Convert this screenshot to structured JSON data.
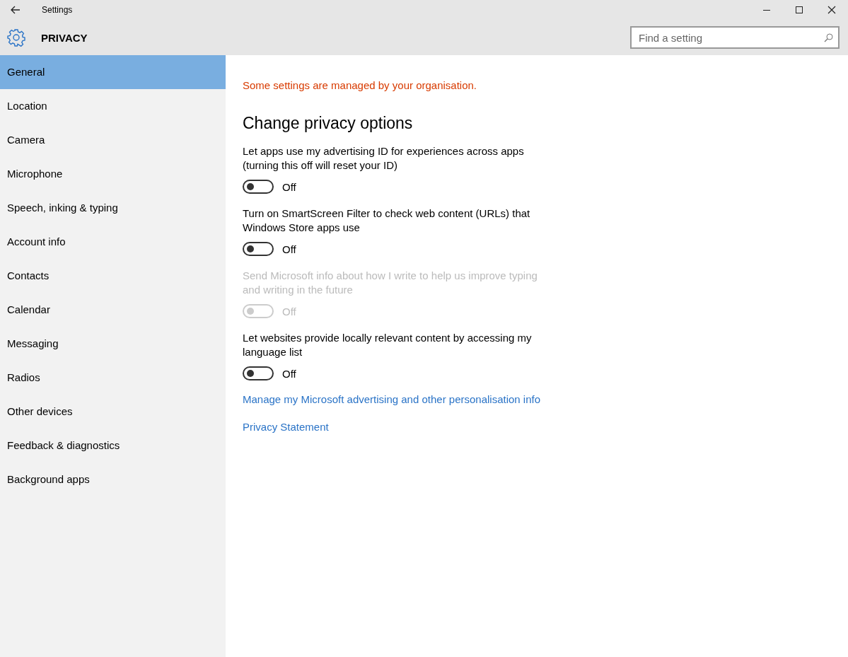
{
  "window": {
    "title": "Settings"
  },
  "header": {
    "title": "PRIVACY",
    "search": {
      "placeholder": "Find a setting"
    }
  },
  "sidebar": {
    "items": [
      {
        "label": "General",
        "selected": true
      },
      {
        "label": "Location",
        "selected": false
      },
      {
        "label": "Camera",
        "selected": false
      },
      {
        "label": "Microphone",
        "selected": false
      },
      {
        "label": "Speech, inking & typing",
        "selected": false
      },
      {
        "label": "Account info",
        "selected": false
      },
      {
        "label": "Contacts",
        "selected": false
      },
      {
        "label": "Calendar",
        "selected": false
      },
      {
        "label": "Messaging",
        "selected": false
      },
      {
        "label": "Radios",
        "selected": false
      },
      {
        "label": "Other devices",
        "selected": false
      },
      {
        "label": "Feedback & diagnostics",
        "selected": false
      },
      {
        "label": "Background apps",
        "selected": false
      }
    ]
  },
  "content": {
    "notice": "Some settings are managed by your organisation.",
    "heading": "Change privacy options",
    "settings": [
      {
        "label": "Let apps use my advertising ID for experiences across apps (turning this off will reset your ID)",
        "on": false,
        "disabled": false,
        "state_label": "Off"
      },
      {
        "label": "Turn on SmartScreen Filter to check web content (URLs) that Windows Store apps use",
        "on": false,
        "disabled": false,
        "state_label": "Off"
      },
      {
        "label": "Send Microsoft info about how I write to help us improve typing and writing in the future",
        "on": false,
        "disabled": true,
        "state_label": "Off"
      },
      {
        "label": "Let websites provide locally relevant content by accessing my language list",
        "on": false,
        "disabled": false,
        "state_label": "Off"
      }
    ],
    "links": [
      "Manage my Microsoft advertising and other personalisation info",
      "Privacy Statement"
    ]
  }
}
